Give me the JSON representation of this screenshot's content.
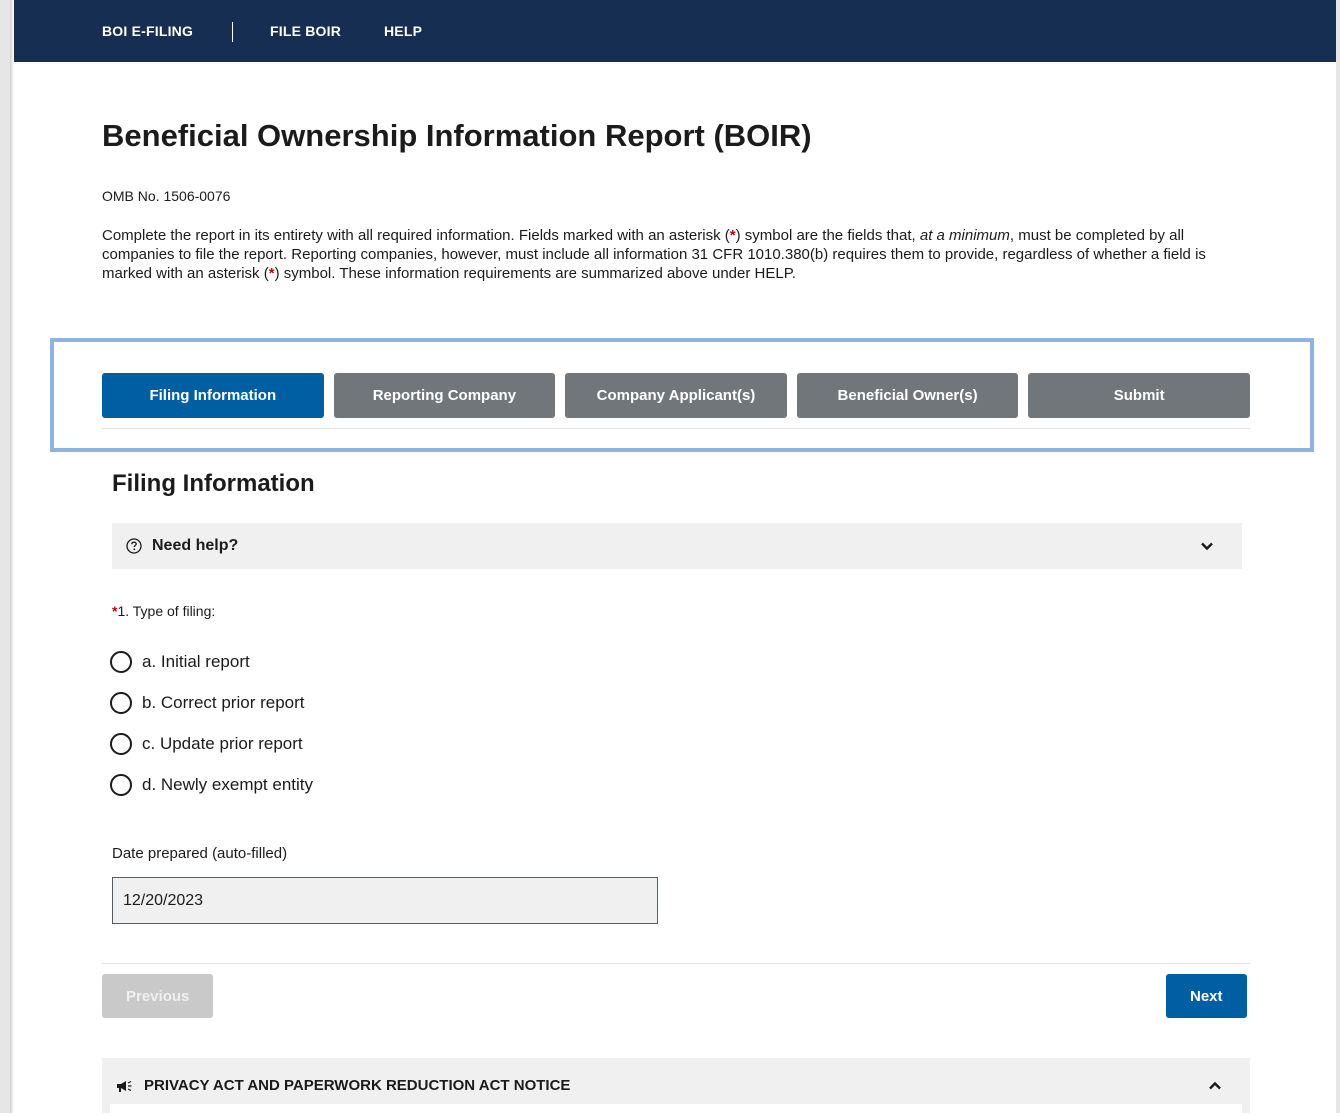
{
  "nav": {
    "brand": "BOI E-FILING",
    "file": "FILE BOIR",
    "help": "HELP"
  },
  "header": {
    "title": "Beneficial Ownership Information Report (BOIR)",
    "omb": "OMB No. 1506-0076",
    "intro_p1": "Complete the report in its entirety with all required information. Fields marked with an asterisk (",
    "asterisk": "*",
    "intro_p2": ") symbol are the fields that, ",
    "intro_em": "at a minimum",
    "intro_p3": ", must be completed by all companies to file the report. Reporting companies, however, must include all information 31 CFR 1010.380(b) requires them to provide, regardless of whether a field is marked with an asterisk (",
    "intro_p4": ") symbol. These information requirements are summarized above under HELP."
  },
  "steps": [
    {
      "label": "Filing Information",
      "active": true
    },
    {
      "label": "Reporting Company",
      "active": false
    },
    {
      "label": "Company Applicant(s)",
      "active": false
    },
    {
      "label": "Beneficial Owner(s)",
      "active": false
    },
    {
      "label": "Submit",
      "active": false
    }
  ],
  "section": {
    "title": "Filing Information",
    "help_label": "Need help?"
  },
  "question": {
    "asterisk": "*",
    "label": "1. Type of filing:",
    "options": [
      "a. Initial report",
      "b. Correct prior report",
      "c. Update prior report",
      "d. Newly exempt entity"
    ]
  },
  "date": {
    "label": "Date prepared (auto-filled)",
    "value": "12/20/2023"
  },
  "buttons": {
    "previous": "Previous",
    "next": "Next"
  },
  "privacy": {
    "label": "PRIVACY ACT AND PAPERWORK REDUCTION ACT NOTICE"
  },
  "colors": {
    "nav_bg": "#162e51",
    "primary": "#005ea2",
    "inactive_step": "#71767a",
    "required": "#b50909",
    "highlight": "#8fb3e0"
  },
  "icons": {
    "help": "question-circle-icon",
    "help_chevron": "chevron-down-icon",
    "privacy": "megaphone-icon",
    "privacy_chevron": "chevron-up-icon"
  }
}
